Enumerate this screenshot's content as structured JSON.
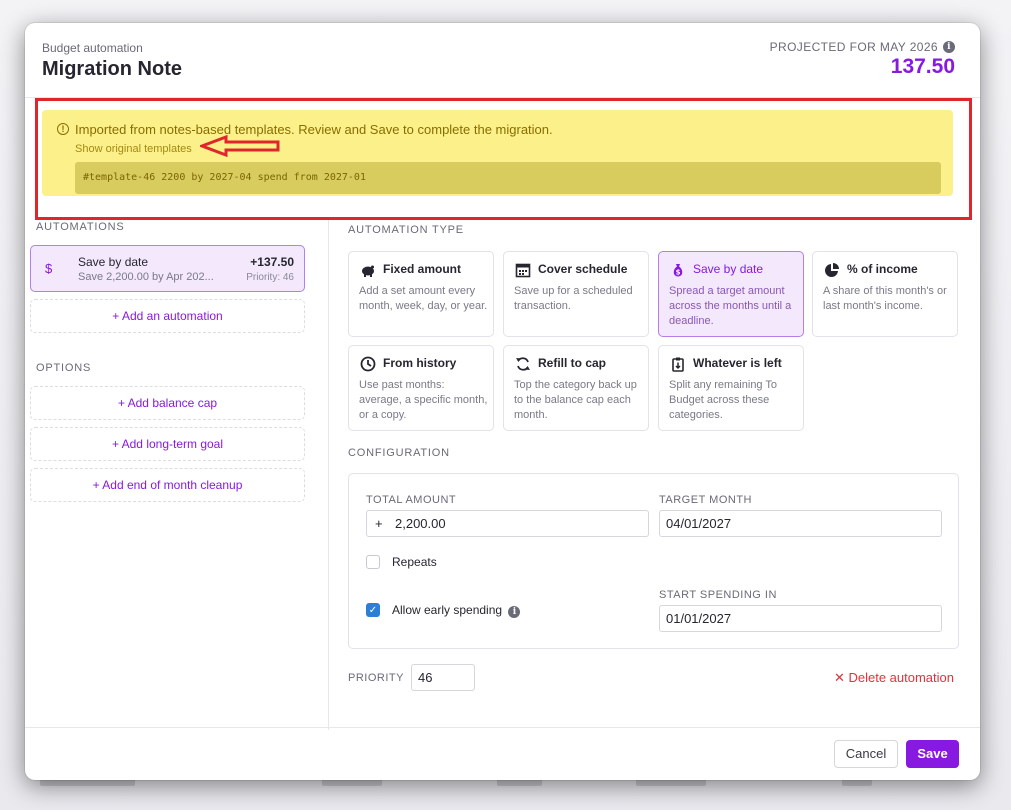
{
  "header": {
    "eyebrow": "Budget automation",
    "title": "Migration Note",
    "projected_label": "PROJECTED FOR MAY 2026",
    "projected_amount": "137.50"
  },
  "banner": {
    "message": "Imported from notes-based templates. Review and Save to complete the migration.",
    "link": "Show original templates",
    "code": "#template-46 2200 by 2027-04 spend from 2027-01"
  },
  "automations": {
    "label": "AUTOMATIONS",
    "item": {
      "name": "Save by date",
      "summary": "Save 2,200.00 by Apr 202...",
      "amount": "+137.50",
      "priority": "Priority: 46"
    },
    "add": "+ Add an automation"
  },
  "options": {
    "label": "OPTIONS",
    "items": [
      "+ Add balance cap",
      "+ Add long-term goal",
      "+ Add end of month cleanup"
    ]
  },
  "type_section": {
    "label": "AUTOMATION TYPE",
    "cards": [
      {
        "name": "Fixed amount",
        "desc": "Add a set amount every month, week, day, or year.",
        "icon": "piggy-bank-icon"
      },
      {
        "name": "Cover schedule",
        "desc": "Save up for a scheduled transaction.",
        "icon": "calendar-icon"
      },
      {
        "name": "Save by date",
        "desc": "Spread a target amount across the months until a deadline.",
        "icon": "money-bag-icon"
      },
      {
        "name": "% of income",
        "desc": "A share of this month's or last month's income.",
        "icon": "pie-chart-icon"
      },
      {
        "name": "From history",
        "desc": "Use past months: average, a specific month, or a copy.",
        "icon": "clock-icon"
      },
      {
        "name": "Refill to cap",
        "desc": "Top the category back up to the balance cap each month.",
        "icon": "refresh-icon"
      },
      {
        "name": "Whatever is left",
        "desc": "Split any remaining To Budget across these categories.",
        "icon": "clipboard-icon"
      }
    ]
  },
  "config": {
    "label": "CONFIGURATION",
    "total_label": "TOTAL AMOUNT",
    "total_prefix": "+",
    "total_value": "2,200.00",
    "target_label": "TARGET MONTH",
    "target_value": "04/01/2027",
    "repeats_label": "Repeats",
    "early_label": "Allow early spending",
    "start_label": "START SPENDING IN",
    "start_value": "01/01/2027"
  },
  "priority": {
    "label": "PRIORITY",
    "value": "46"
  },
  "delete_label": "Delete automation",
  "footer": {
    "cancel": "Cancel",
    "save": "Save"
  },
  "colors": {
    "accent": "#8719e0",
    "banner": "#fbf08a",
    "annotation": "#e0262d",
    "danger": "#e0333b"
  }
}
